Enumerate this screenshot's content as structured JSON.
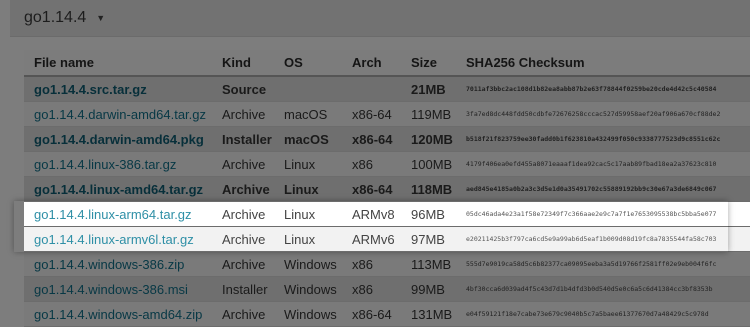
{
  "version_toggle": {
    "label": "go1.14.4"
  },
  "columns": [
    "File name",
    "Kind",
    "OS",
    "Arch",
    "Size",
    "SHA256 Checksum"
  ],
  "rows": [
    {
      "file": "go1.14.4.src.tar.gz",
      "kind": "Source",
      "os": "",
      "arch": "",
      "size": "21MB",
      "sha": "7011af3bbc2ac108d1b82ea8abb87b2e63f78844f0259be20cde4d42c5c40584",
      "bold": true,
      "highlighted": false
    },
    {
      "file": "go1.14.4.darwin-amd64.tar.gz",
      "kind": "Archive",
      "os": "macOS",
      "arch": "x86-64",
      "size": "119MB",
      "sha": "3fa7ed8dc448fdd50cdbfe72676258cccac527d59958aef20af906a670cf88de2",
      "bold": false,
      "highlighted": false
    },
    {
      "file": "go1.14.4.darwin-amd64.pkg",
      "kind": "Installer",
      "os": "macOS",
      "arch": "x86-64",
      "size": "120MB",
      "sha": "b518f21f823759ee30fadd0b1f623810a432499f050c9338777523d9c8551c62c",
      "bold": true,
      "highlighted": false
    },
    {
      "file": "go1.14.4.linux-386.tar.gz",
      "kind": "Archive",
      "os": "Linux",
      "arch": "x86",
      "size": "100MB",
      "sha": "4179f406ea0efd455a8071eaaaf1dea92cac5c17aab89fbad18ea2a37623c810",
      "bold": false,
      "highlighted": false
    },
    {
      "file": "go1.14.4.linux-amd64.tar.gz",
      "kind": "Archive",
      "os": "Linux",
      "arch": "x86-64",
      "size": "118MB",
      "sha": "aed845e4185a0b2a3c3d5e1d0a35491702c55889192bb9c30e67a3de6849c067",
      "bold": true,
      "highlighted": false
    },
    {
      "file": "go1.14.4.linux-arm64.tar.gz",
      "kind": "Archive",
      "os": "Linux",
      "arch": "ARMv8",
      "size": "96MB",
      "sha": "05dc46ada4e23a1f58e72349f7c366aae2e9c7a7f1e7653095538bc5bba5e077",
      "bold": false,
      "highlighted": true
    },
    {
      "file": "go1.14.4.linux-armv6l.tar.gz",
      "kind": "Archive",
      "os": "Linux",
      "arch": "ARMv6",
      "size": "97MB",
      "sha": "e20211425b3f797ca6cd5e9a99ab6d5eaf1b009d08d19fc8a7835544fa58c703",
      "bold": false,
      "highlighted": true
    },
    {
      "file": "go1.14.4.windows-386.zip",
      "kind": "Archive",
      "os": "Windows",
      "arch": "x86",
      "size": "113MB",
      "sha": "555d7e9019ca58d5c6b82377ca09095eeba3a5d19766f2581ff02e9eb004f6fc",
      "bold": false,
      "highlighted": false
    },
    {
      "file": "go1.14.4.windows-386.msi",
      "kind": "Installer",
      "os": "Windows",
      "arch": "x86",
      "size": "99MB",
      "sha": "4bf30cca6d039ad4f5c43d7d1b4dfd3b0d540d5e0c6a5c6d41384cc3bf8353b",
      "bold": false,
      "highlighted": false
    },
    {
      "file": "go1.14.4.windows-amd64.zip",
      "kind": "Archive",
      "os": "Windows",
      "arch": "x86-64",
      "size": "131MB",
      "sha": "e04f59121f18e7cabe73e679c9040b5c7a5baee61377670d7a48429c5c978d",
      "bold": false,
      "highlighted": false
    }
  ]
}
